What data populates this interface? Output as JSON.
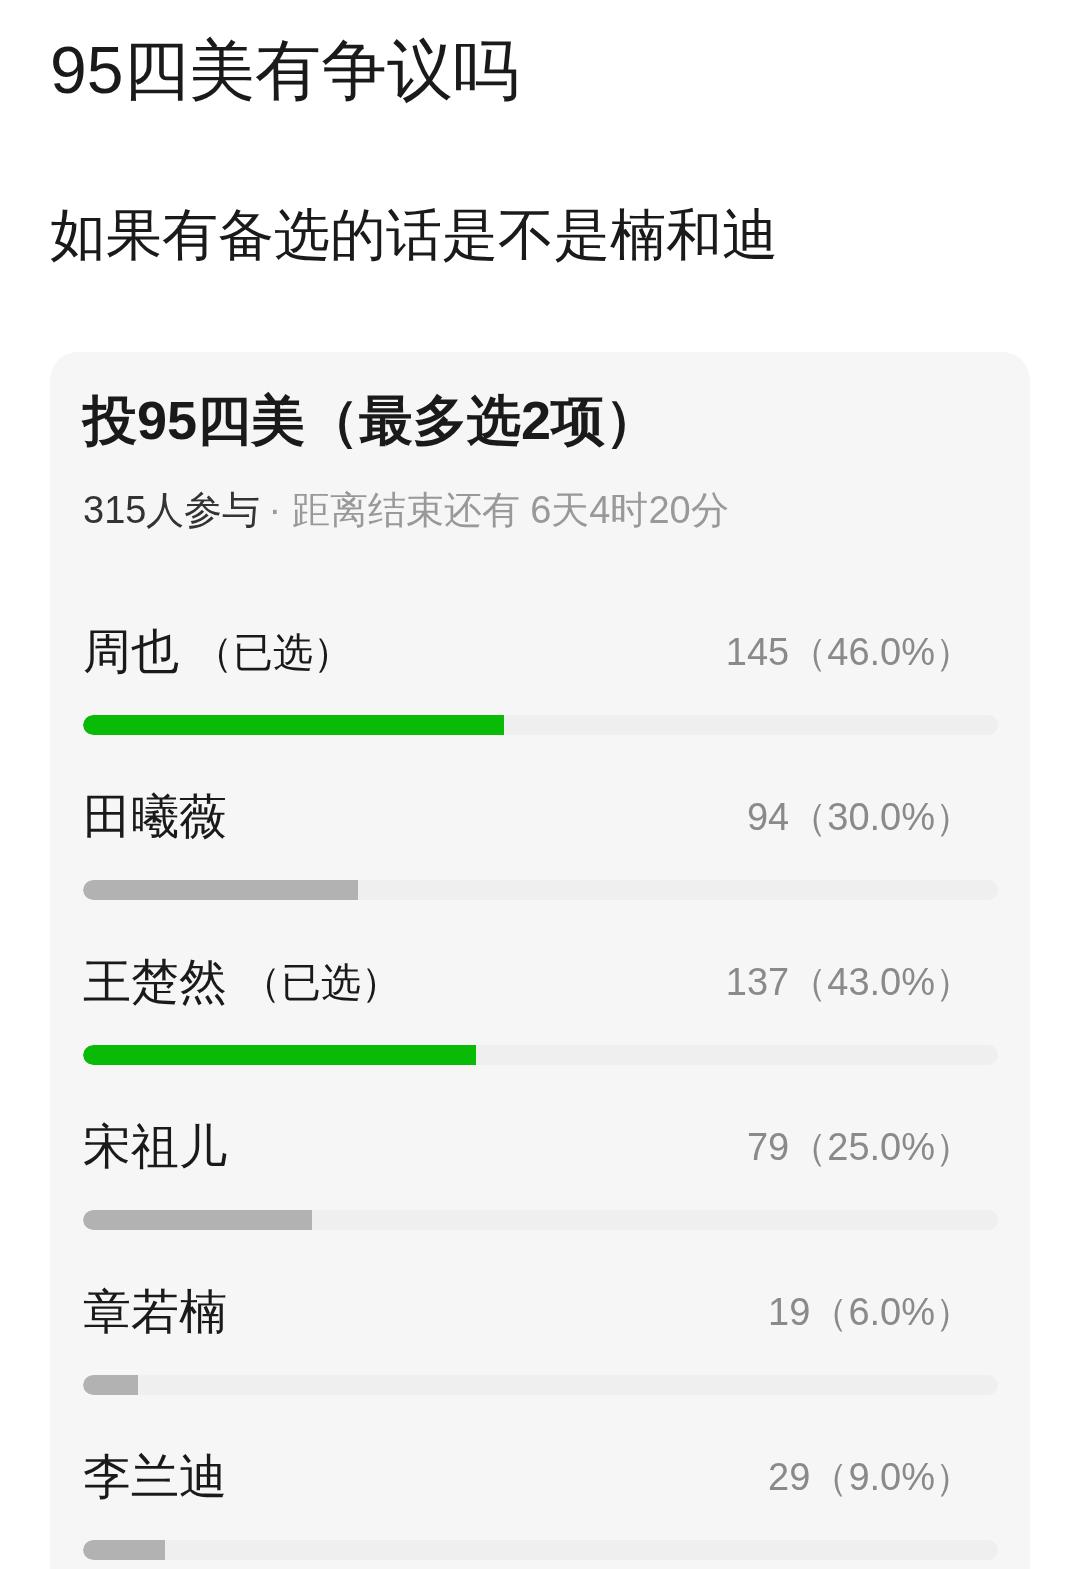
{
  "post": {
    "title": "95四美有争议吗",
    "body": "如果有备选的话是不是楠和迪"
  },
  "poll": {
    "title": "投95四美（最多选2项）",
    "participants": "315人参与",
    "deadline": "· 距离结束还有 6天4时20分",
    "options": [
      {
        "name": "周也",
        "tag": "（已选）",
        "selected": true,
        "result": "145（46.0%）",
        "level": 0.46
      },
      {
        "name": "田曦薇",
        "selected": false,
        "result": "94（30.0%）",
        "level": 0.3
      },
      {
        "name": "王楚然",
        "tag": "（已选）",
        "selected": true,
        "result": "137（43.0%）",
        "level": 0.43
      },
      {
        "name": "宋祖儿",
        "selected": false,
        "result": "79（25.0%）",
        "level": 0.25
      },
      {
        "name": "章若楠",
        "selected": false,
        "result": "19（6.0%）",
        "level": 0.06
      },
      {
        "name": "李兰迪",
        "selected": false,
        "result": "29（9.0%）",
        "level": 0.09
      }
    ]
  }
}
